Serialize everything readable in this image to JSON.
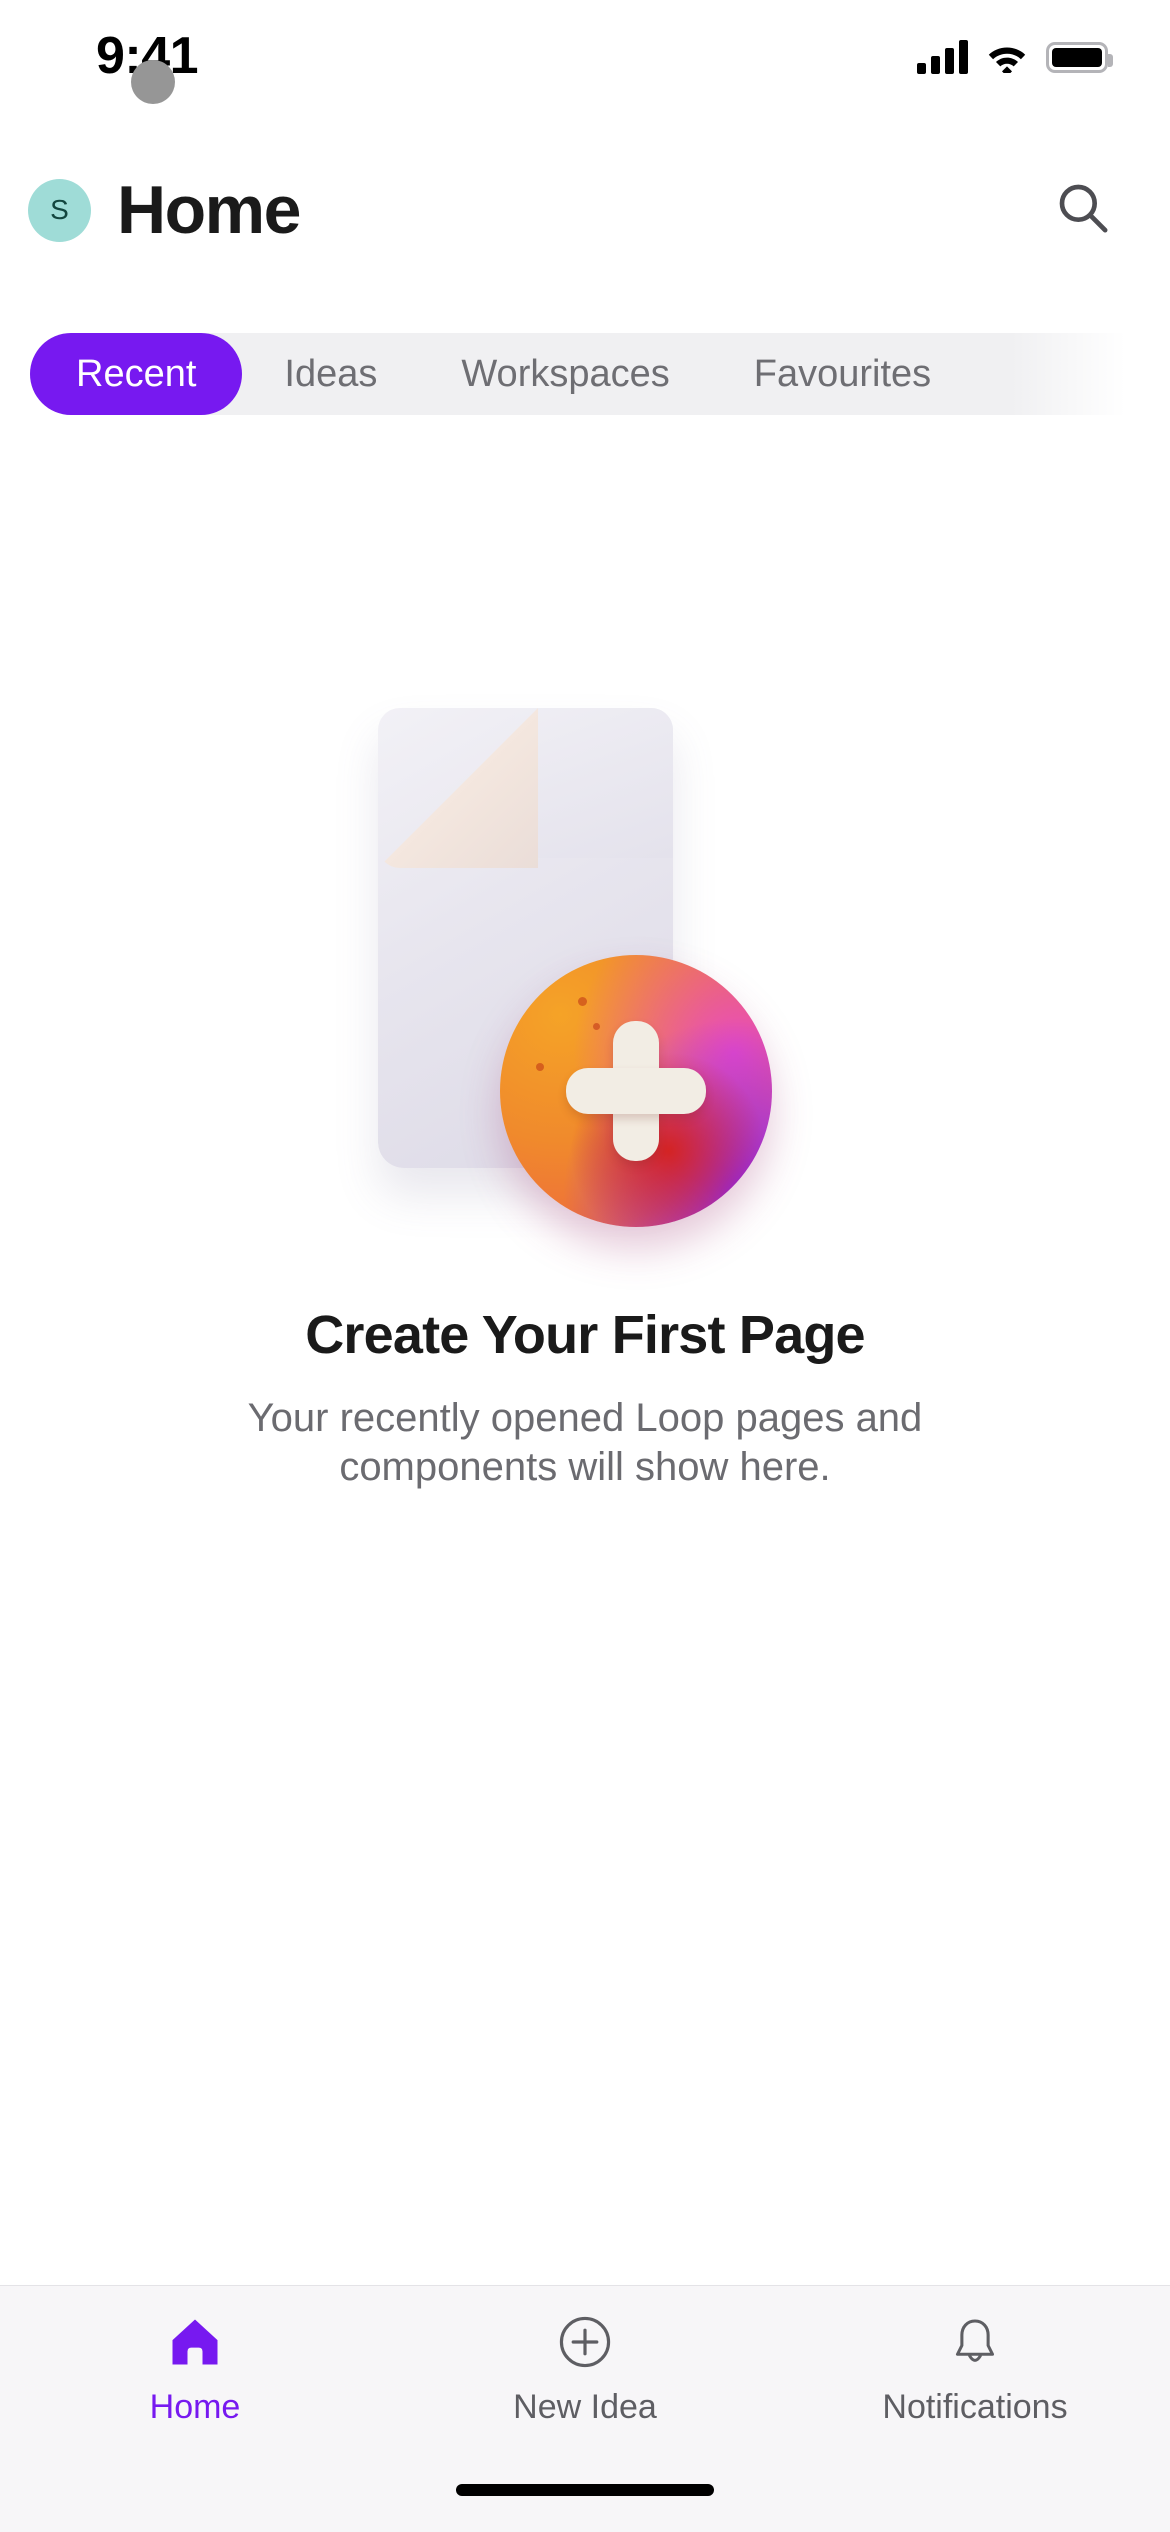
{
  "status_bar": {
    "time": "9:41",
    "cellular_icon": "cellular-signal-icon",
    "wifi_icon": "wifi-icon",
    "battery_icon": "battery-full-icon"
  },
  "header": {
    "avatar_initial": "S",
    "avatar_bg": "#9FDCD7",
    "avatar_fg": "#12463F",
    "title": "Home",
    "search_icon": "search-icon"
  },
  "tabs": {
    "items": [
      {
        "label": "Recent",
        "active": true
      },
      {
        "label": "Ideas",
        "active": false
      },
      {
        "label": "Workspaces",
        "active": false
      },
      {
        "label": "Favourites",
        "active": false
      }
    ],
    "active_bg": "#7719F0",
    "active_fg": "#FFFFFF",
    "strip_bg": "#F0F0F2",
    "inactive_fg": "#6E6E73"
  },
  "empty_state": {
    "illustration": "new-page-illustration",
    "title": "Create Your First Page",
    "subtitle": "Your recently opened Loop pages and components will show here."
  },
  "bottom_nav": {
    "items": [
      {
        "label": "Home",
        "icon": "home-icon",
        "active": true
      },
      {
        "label": "New Idea",
        "icon": "plus-circle-icon",
        "active": false
      },
      {
        "label": "Notifications",
        "icon": "bell-icon",
        "active": false
      }
    ],
    "active_color": "#7719F0",
    "inactive_color": "#5E5E63",
    "background": "#F7F6F8"
  },
  "system": {
    "home_indicator": "home-indicator",
    "touch_indicator": "touch-indicator-dot"
  }
}
